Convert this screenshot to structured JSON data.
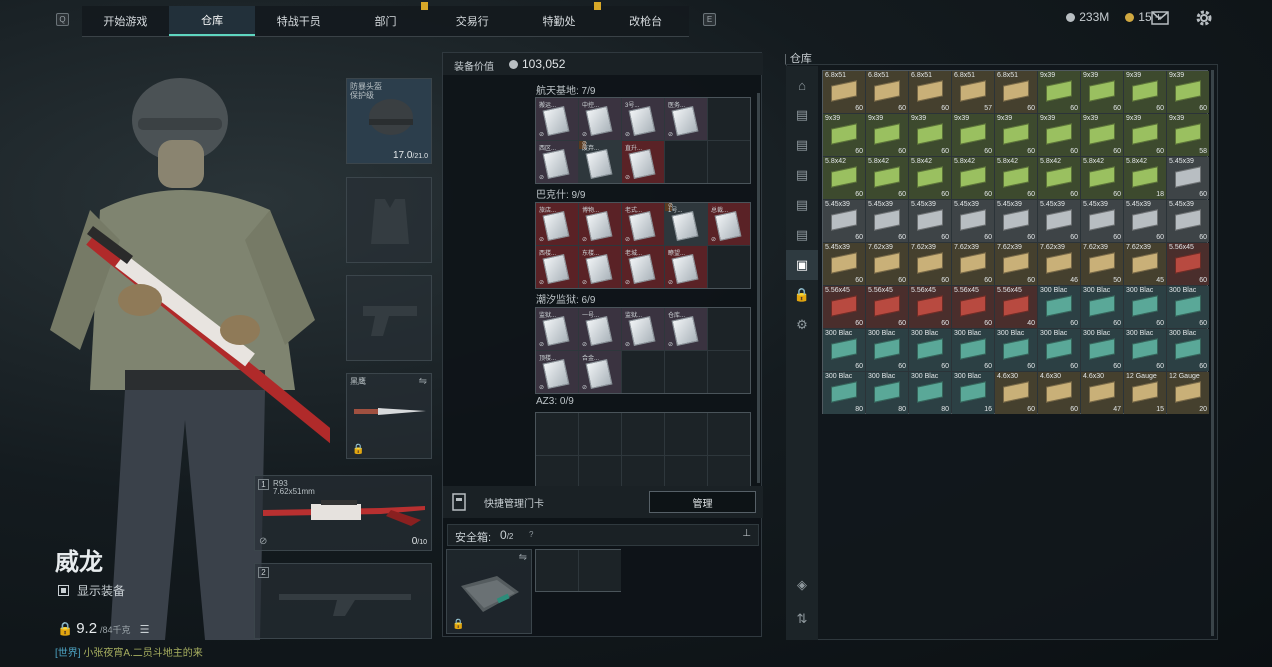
{
  "nav": {
    "left_key": "Q",
    "right_key": "E",
    "tabs": [
      "开始游戏",
      "仓库",
      "特战干员",
      "部门",
      "交易行",
      "特勤处",
      "改枪台"
    ],
    "active": 1
  },
  "currency": {
    "coins": "233M",
    "tokens": "15",
    "plus": "+"
  },
  "character": {
    "name": "威龙",
    "show_gear": "显示装备",
    "weight": "9.2",
    "weight_max": "/84千克"
  },
  "chat": {
    "channel": "[世界]",
    "text": "小张夜宵A.二员斗地主的来"
  },
  "equip": {
    "helmet": {
      "label": "防暴头盔",
      "label2": "保护级",
      "value": "17.0",
      "max": "/21.0"
    },
    "melee": {
      "label": "黑鹰"
    },
    "primary": {
      "slot": "1",
      "name": "R93",
      "ammo": "7.62x51mm",
      "count": "0",
      "count_max": "/10"
    },
    "secondary": {
      "slot": "2"
    }
  },
  "center": {
    "gear_value_label": "装备价值",
    "gear_value": "103,052",
    "sections": [
      {
        "title": "航天基地: 7/9"
      },
      {
        "title": "巴克什: 9/9"
      },
      {
        "title": "潮汐监狱: 6/9"
      },
      {
        "title": "AZ3: 0/9"
      }
    ],
    "quick_card": "快捷管理门卡",
    "manage": "管理",
    "safe_label": "安全箱:",
    "safe_count": "0",
    "safe_max": "/2",
    "safe_help": "?"
  },
  "cards": {
    "s1": [
      [
        "搬运...",
        "sel"
      ],
      [
        "中控...",
        "sel"
      ],
      [
        "3号...",
        "sel"
      ],
      [
        "医务...",
        "sel"
      ],
      [
        "",
        "empty"
      ],
      [
        "西区...",
        "sel"
      ],
      [
        "废弃...",
        "gold"
      ],
      [
        "直升...",
        "red"
      ]
    ],
    "s2": [
      [
        "旅店...",
        "red"
      ],
      [
        "博物...",
        "red"
      ],
      [
        "老式...",
        "red"
      ],
      [
        "1号...",
        "gold"
      ],
      [
        "总裁...",
        "red"
      ],
      [
        "西楼...",
        "red"
      ],
      [
        "东楼...",
        "red"
      ],
      [
        "老城...",
        "red"
      ],
      [
        "瞭望...",
        "red"
      ]
    ],
    "s3": [
      [
        "监狱...",
        "sel"
      ],
      [
        "一号...",
        "sel"
      ],
      [
        "监狱...",
        "sel"
      ],
      [
        "仓库...",
        "sel"
      ],
      [
        "",
        "empty"
      ],
      [
        "顶楼...",
        "sel"
      ],
      [
        "合金...",
        "sel"
      ]
    ]
  },
  "stash": {
    "title": "仓库",
    "items": [
      [
        "6.8x51",
        "60",
        "n"
      ],
      [
        "6.8x51",
        "60",
        "n"
      ],
      [
        "6.8x51",
        "60",
        "n"
      ],
      [
        "6.8x51",
        "57",
        "n"
      ],
      [
        "6.8x51",
        "60",
        "n"
      ],
      [
        "9x39",
        "60",
        "g"
      ],
      [
        "9x39",
        "60",
        "g"
      ],
      [
        "9x39",
        "60",
        "g"
      ],
      [
        "9x39",
        "60",
        "g"
      ],
      [
        "9x39",
        "60",
        "g"
      ],
      [
        "9x39",
        "60",
        "g"
      ],
      [
        "9x39",
        "60",
        "g"
      ],
      [
        "9x39",
        "60",
        "g"
      ],
      [
        "9x39",
        "60",
        "g"
      ],
      [
        "9x39",
        "60",
        "g"
      ],
      [
        "9x39",
        "60",
        "g"
      ],
      [
        "9x39",
        "60",
        "g"
      ],
      [
        "9x39",
        "58",
        "g"
      ],
      [
        "5.8x42",
        "60",
        "g"
      ],
      [
        "5.8x42",
        "60",
        "g"
      ],
      [
        "5.8x42",
        "60",
        "g"
      ],
      [
        "5.8x42",
        "60",
        "g"
      ],
      [
        "5.8x42",
        "60",
        "g"
      ],
      [
        "5.8x42",
        "60",
        "g"
      ],
      [
        "5.8x42",
        "60",
        "g"
      ],
      [
        "5.8x42",
        "18",
        "g"
      ],
      [
        "5.45x39",
        "60",
        "gr"
      ],
      [
        "5.45x39",
        "60",
        "gr"
      ],
      [
        "5.45x39",
        "60",
        "gr"
      ],
      [
        "5.45x39",
        "60",
        "gr"
      ],
      [
        "5.45x39",
        "60",
        "gr"
      ],
      [
        "5.45x39",
        "60",
        "gr"
      ],
      [
        "5.45x39",
        "60",
        "gr"
      ],
      [
        "5.45x39",
        "60",
        "gr"
      ],
      [
        "5.45x39",
        "60",
        "gr"
      ],
      [
        "5.45x39",
        "60",
        "gr"
      ],
      [
        "5.45x39",
        "60",
        "n"
      ],
      [
        "7.62x39",
        "60",
        "n"
      ],
      [
        "7.62x39",
        "60",
        "n"
      ],
      [
        "7.62x39",
        "60",
        "n"
      ],
      [
        "7.62x39",
        "60",
        "n"
      ],
      [
        "7.62x39",
        "46",
        "n"
      ],
      [
        "7.62x39",
        "50",
        "n"
      ],
      [
        "7.62x39",
        "45",
        "n"
      ],
      [
        "5.56x45",
        "60",
        "r"
      ],
      [
        "5.56x45",
        "60",
        "r"
      ],
      [
        "5.56x45",
        "60",
        "r"
      ],
      [
        "5.56x45",
        "60",
        "r"
      ],
      [
        "5.56x45",
        "60",
        "r"
      ],
      [
        "5.56x45",
        "40",
        "r"
      ],
      [
        "300 Blac",
        "60",
        "t"
      ],
      [
        "300 Blac",
        "60",
        "t"
      ],
      [
        "300 Blac",
        "60",
        "t"
      ],
      [
        "300 Blac",
        "60",
        "t"
      ],
      [
        "300 Blac",
        "60",
        "t"
      ],
      [
        "300 Blac",
        "60",
        "t"
      ],
      [
        "300 Blac",
        "60",
        "t"
      ],
      [
        "300 Blac",
        "60",
        "t"
      ],
      [
        "300 Blac",
        "60",
        "t"
      ],
      [
        "300 Blac",
        "60",
        "t"
      ],
      [
        "300 Blac",
        "60",
        "t"
      ],
      [
        "300 Blac",
        "60",
        "t"
      ],
      [
        "300 Blac",
        "60",
        "t"
      ],
      [
        "300 Blac",
        "80",
        "t"
      ],
      [
        "300 Blac",
        "80",
        "t"
      ],
      [
        "300 Blac",
        "80",
        "t"
      ],
      [
        "300 Blac",
        "16",
        "t"
      ],
      [
        "4.6x30",
        "60",
        "n"
      ],
      [
        "4.6x30",
        "60",
        "n"
      ],
      [
        "4.6x30",
        "47",
        "n"
      ],
      [
        "12 Gauge",
        "15",
        "n"
      ],
      [
        "12 Gauge",
        "20",
        "n"
      ]
    ]
  }
}
